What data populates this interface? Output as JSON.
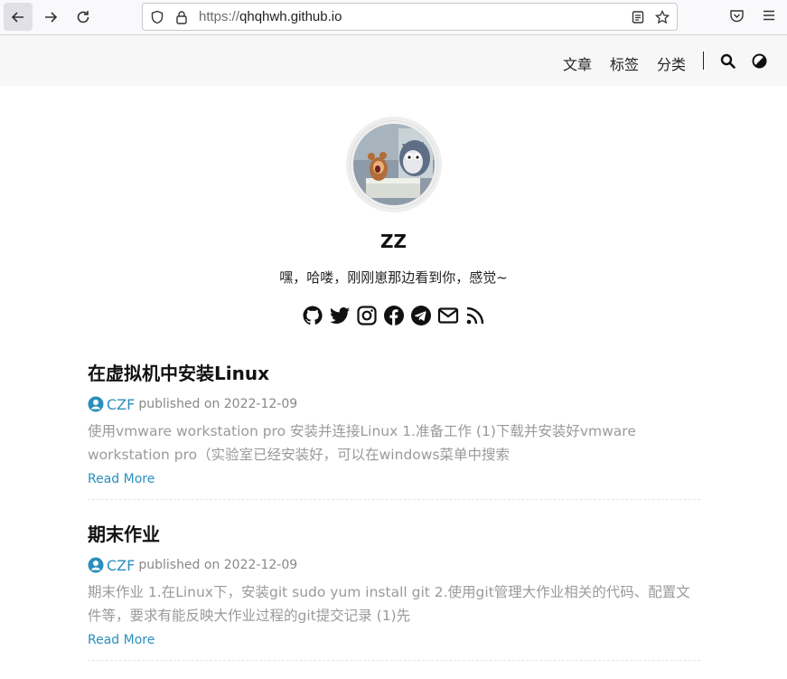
{
  "browser": {
    "url_protocol": "https://",
    "url_host": "qhqhwh.github.io"
  },
  "header": {
    "nav": [
      "文章",
      "标签",
      "分类"
    ]
  },
  "profile": {
    "name": "ZZ",
    "bio": "嘿，哈喽，刚刚崽那边看到你，感觉~",
    "social_icons": [
      "github-icon",
      "twitter-icon",
      "instagram-icon",
      "facebook-icon",
      "telegram-icon",
      "mail-icon",
      "rss-icon"
    ]
  },
  "posts": [
    {
      "title": "在虚拟机中安装Linux",
      "author": "CZF",
      "published": "published on 2022-12-09",
      "summary": "使用vmware workstation pro 安装并连接Linux 1.准备工作 (1)下载并安装好vmware workstation pro（实验室已经安装好，可以在windows菜单中搜索",
      "read_more": "Read More"
    },
    {
      "title": "期末作业",
      "author": "CZF",
      "published": "published on 2022-12-09",
      "summary": "期末作业 1.在Linux下，安装git sudo yum install git 2.使用git管理大作业相关的代码、配置文件等，要求有能反映大作业过程的git提交记录 (1)先",
      "read_more": "Read More"
    }
  ],
  "colors": {
    "accent": "#2a8fbd",
    "header_bg": "#f7f7f7",
    "summary_text": "#9a9a9a"
  }
}
